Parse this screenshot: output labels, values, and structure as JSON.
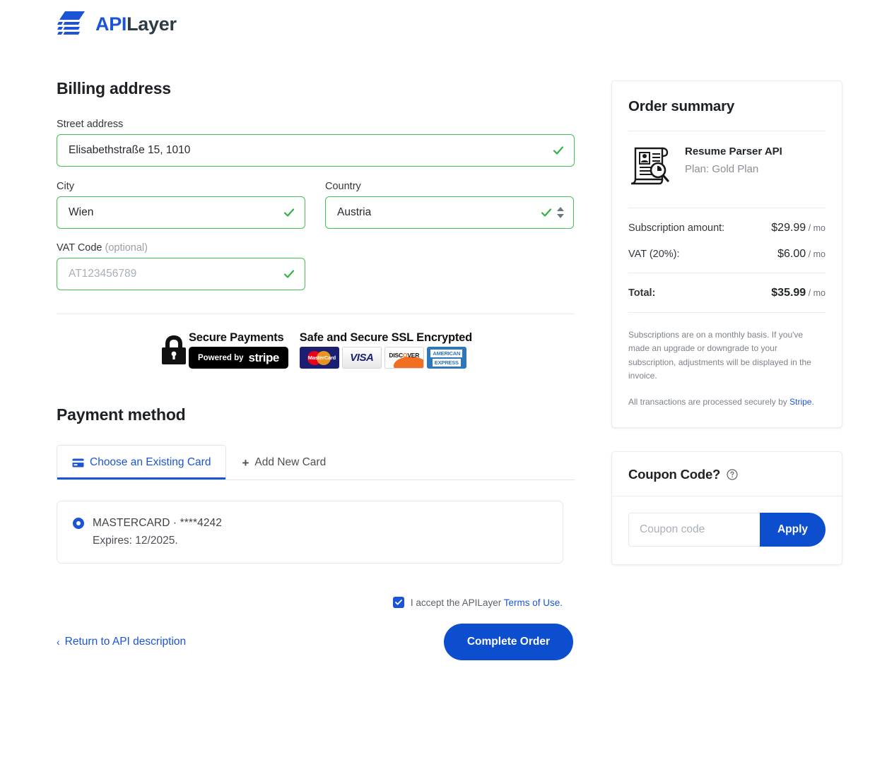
{
  "brand": {
    "api": "API",
    "layer": "Layer"
  },
  "billing": {
    "heading": "Billing address",
    "street_label": "Street address",
    "street_value": "Elisabethstraße 15, 1010",
    "city_label": "City",
    "city_value": "Wien",
    "country_label": "Country",
    "country_value": "Austria",
    "vat_label": "VAT Code",
    "vat_optional": "(optional)",
    "vat_placeholder": "AT123456789"
  },
  "trust": {
    "secure_payments": "Secure Payments",
    "powered_by": "Powered by",
    "stripe": "stripe",
    "ssl": "Safe and Secure SSL Encrypted",
    "cards": {
      "mastercard": "MasterCard",
      "visa": "VISA",
      "discover_a": "DISC",
      "discover_o": "O",
      "discover_b": "VER",
      "amex_line1": "AMERICAN",
      "amex_line2": "EXPRESS"
    }
  },
  "payment": {
    "heading": "Payment method",
    "tab_existing": "Choose an Existing Card",
    "tab_new": "Add New Card",
    "tab_new_plus": "+",
    "card_name": "MASTERCARD · ****4242",
    "card_expires": "Expires: 12/2025."
  },
  "footer": {
    "terms_prefix": "I accept the APILayer ",
    "terms_link": "Terms of Use.",
    "back_chevron": "‹",
    "back_link": "Return to API description",
    "complete_order": "Complete Order"
  },
  "summary": {
    "heading": "Order summary",
    "product_name": "Resume Parser API",
    "product_plan": "Plan: Gold Plan",
    "rows": [
      {
        "label": "Subscription amount:",
        "amount": "$29.99",
        "per": " / mo"
      },
      {
        "label": "VAT (20%):",
        "amount": "$6.00",
        "per": " / mo"
      }
    ],
    "total_label": "Total:",
    "total_amount": "$35.99",
    "total_per": " / mo",
    "fineprint_1": "Subscriptions are on a monthly basis. If you've made an upgrade or downgrade to your subscription, adjustments will be displayed in the invoice.",
    "fineprint_2_prefix": "All transactions are processed securely by ",
    "fineprint_2_link": "Stripe",
    "fineprint_2_suffix": "."
  },
  "coupon": {
    "title": "Coupon Code?",
    "placeholder": "Coupon code",
    "apply": "Apply"
  },
  "colors": {
    "brand_blue": "#1b55d6",
    "button_blue": "#0d4ecf",
    "valid_green": "#44c057",
    "text_dark": "#1d2125",
    "muted": "#8a9097"
  }
}
